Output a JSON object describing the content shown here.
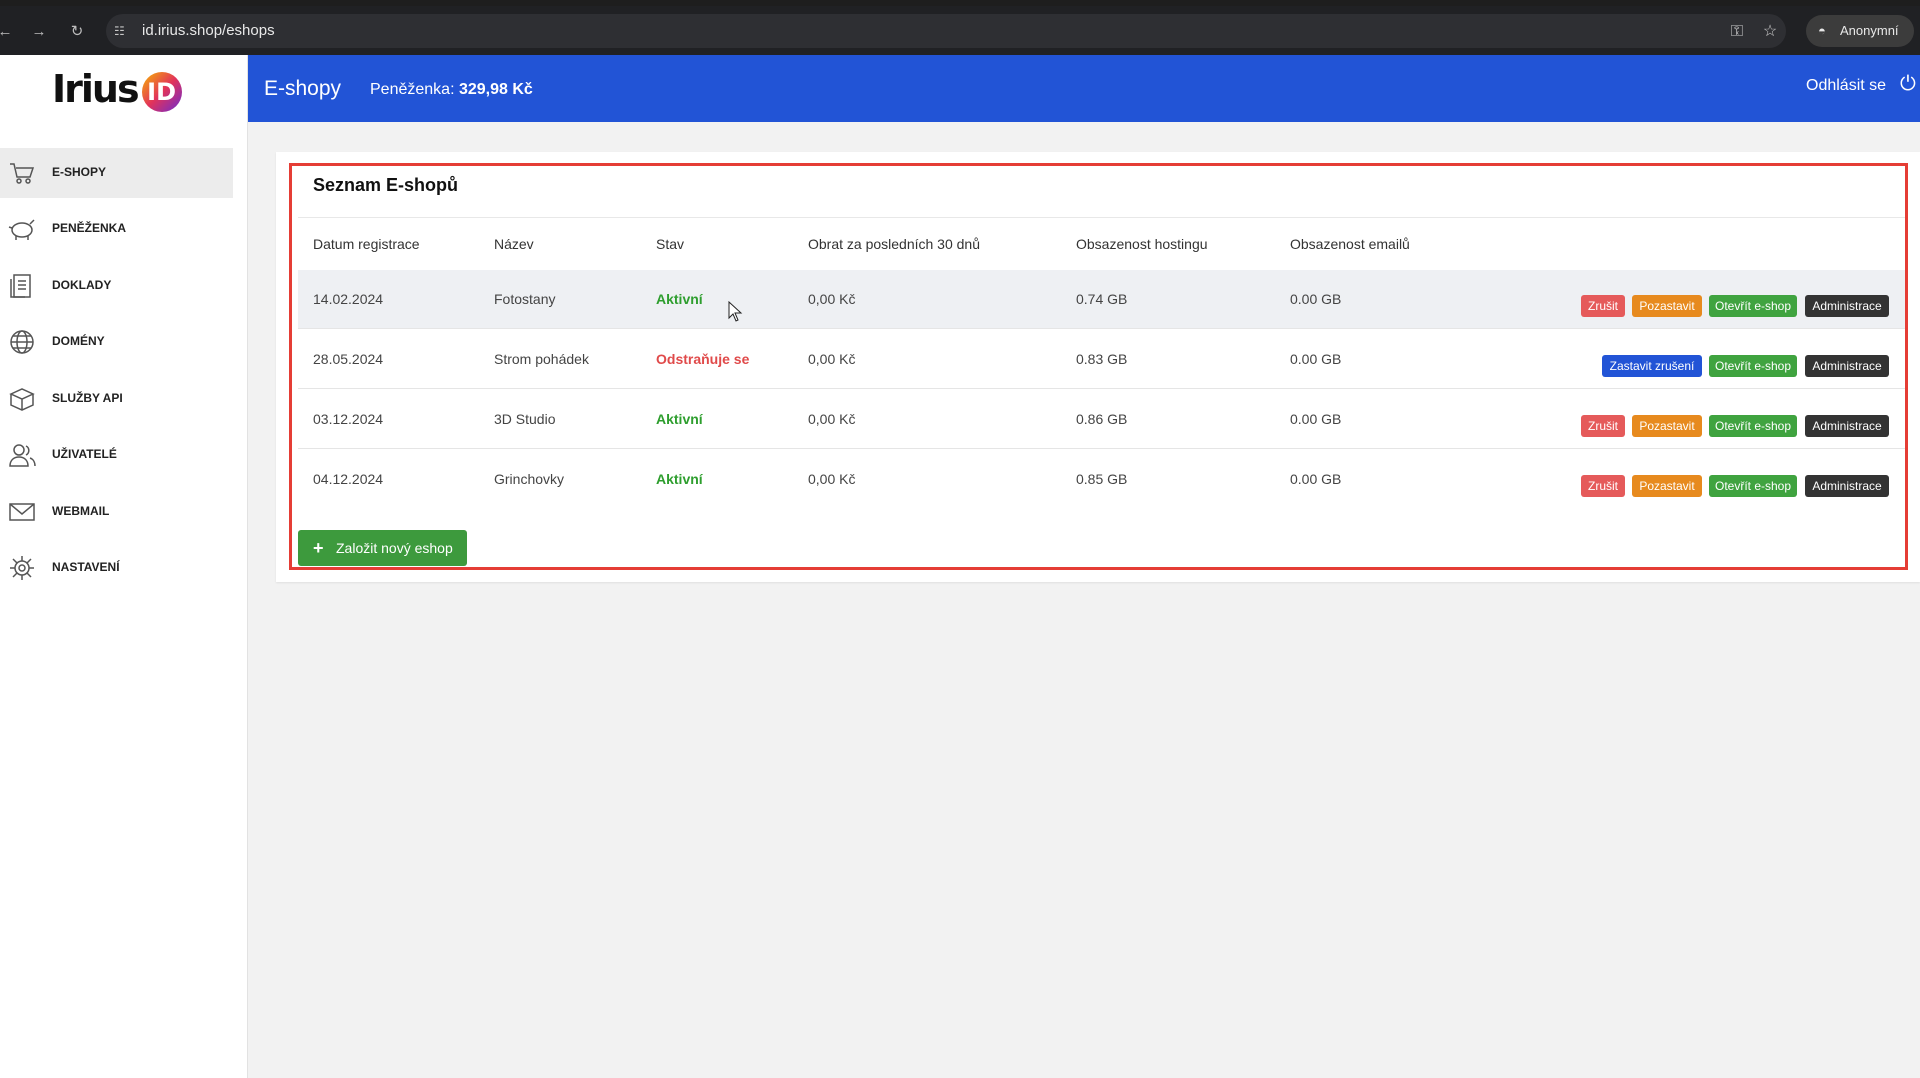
{
  "browser": {
    "url": "id.irius.shop/eshops",
    "profile_label": "Anonymní"
  },
  "logo": {
    "text": "Irius",
    "badge": "ID"
  },
  "sidebar": {
    "items": [
      {
        "label": "E-SHOPY",
        "icon": "cart-icon"
      },
      {
        "label": "PENĚŽENKA",
        "icon": "piggy-bank-icon"
      },
      {
        "label": "DOKLADY",
        "icon": "documents-icon"
      },
      {
        "label": "DOMÉNY",
        "icon": "globe-icon"
      },
      {
        "label": "SLUŽBY API",
        "icon": "box-icon"
      },
      {
        "label": "UŽIVATELÉ",
        "icon": "users-icon"
      },
      {
        "label": "WEBMAIL",
        "icon": "mail-icon"
      },
      {
        "label": "NASTAVENÍ",
        "icon": "gear-icon"
      }
    ]
  },
  "header": {
    "title": "E-shopy",
    "wallet_label": "Peněženka:",
    "wallet_value": "329,98 Kč",
    "logout_label": "Odhlásit se"
  },
  "main": {
    "card_title": "Seznam E-shopů",
    "columns": [
      "Datum registrace",
      "Název",
      "Stav",
      "Obrat za posledních 30 dnů",
      "Obsazenost hostingu",
      "Obsazenost emailů"
    ],
    "rows": [
      {
        "date": "14.02.2024",
        "name": "Fotostany",
        "status": "Aktivní",
        "turnover": "0,00 Kč",
        "hosting": "0.74 GB",
        "email": "0.00 GB"
      },
      {
        "date": "28.05.2024",
        "name": "Strom pohádek",
        "status": "Odstraňuje se",
        "turnover": "0,00 Kč",
        "hosting": "0.83 GB",
        "email": "0.00 GB"
      },
      {
        "date": "03.12.2024",
        "name": "3D Studio",
        "status": "Aktivní",
        "turnover": "0,00 Kč",
        "hosting": "0.86 GB",
        "email": "0.00 GB"
      },
      {
        "date": "04.12.2024",
        "name": "Grinchovky",
        "status": "Aktivní",
        "turnover": "0,00 Kč",
        "hosting": "0.85 GB",
        "email": "0.00 GB"
      }
    ],
    "actions": {
      "cancel": "Zrušit",
      "pause": "Pozastavit",
      "open_eshop": "Otevřít e-shop",
      "admin": "Administrace",
      "stop_cancel": "Zastavit zrušení"
    },
    "add_button": "Založit nový eshop"
  },
  "colors": {
    "header_bg": "#2254d6",
    "active_status": "#2e9e2e",
    "removing_status": "#e04a4a",
    "highlight_border": "#e53d35"
  }
}
